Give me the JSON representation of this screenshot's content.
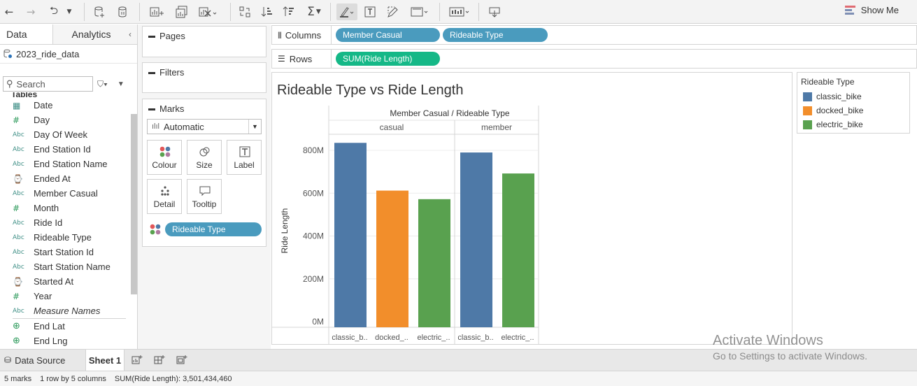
{
  "toolbar": {
    "show_me_label": "Show Me",
    "icons": [
      "back-arrow-icon",
      "forward-arrow-icon",
      "redo-icon",
      "dropdown-icon",
      "new-datasource-icon",
      "pause-updates-icon",
      "new-worksheet-icon",
      "duplicate-sheet-icon",
      "clear-sheet-icon",
      "swap-rows-columns-icon",
      "sort-ascending-icon",
      "sort-descending-icon",
      "totals-icon",
      "highlight-icon",
      "show-labels-icon",
      "pen-icon",
      "fit-icon",
      "present-icon",
      "share-icon"
    ]
  },
  "left_pane": {
    "tabs": {
      "data": "Data",
      "analytics": "Analytics"
    },
    "datasource": "2023_ride_data",
    "search_placeholder": "Search",
    "tables_label": "Tables",
    "fields": [
      {
        "type": "date",
        "name": "Date"
      },
      {
        "type": "number",
        "name": "Day"
      },
      {
        "type": "text",
        "name": "Day Of Week"
      },
      {
        "type": "text",
        "name": "End Station Id"
      },
      {
        "type": "text",
        "name": "End Station Name"
      },
      {
        "type": "datetime",
        "name": "Ended At"
      },
      {
        "type": "text",
        "name": "Member Casual"
      },
      {
        "type": "number",
        "name": "Month"
      },
      {
        "type": "text",
        "name": "Ride Id"
      },
      {
        "type": "text",
        "name": "Rideable Type"
      },
      {
        "type": "text",
        "name": "Start Station Id"
      },
      {
        "type": "text",
        "name": "Start Station Name"
      },
      {
        "type": "datetime",
        "name": "Started At"
      },
      {
        "type": "number",
        "name": "Year"
      },
      {
        "type": "text",
        "name": "Measure Names",
        "italic": true
      },
      {
        "type": "geo",
        "name": "End Lat"
      },
      {
        "type": "geo",
        "name": "End Lng"
      }
    ]
  },
  "cards": {
    "pages": "Pages",
    "filters": "Filters",
    "marks": "Marks",
    "mark_type": "Automatic",
    "buttons": {
      "colour": "Colour",
      "size": "Size",
      "label": "Label",
      "detail": "Detail",
      "tooltip": "Tooltip"
    },
    "colour_pill": "Rideable Type"
  },
  "shelves": {
    "columns_label": "Columns",
    "columns_pills": [
      "Member Casual",
      "Rideable Type"
    ],
    "rows_label": "Rows",
    "rows_pills": [
      "SUM(Ride Length)"
    ]
  },
  "viz": {
    "title": "Rideable Type vs Ride Length"
  },
  "legend": {
    "title": "Rideable Type",
    "items": [
      {
        "label": "classic_bike",
        "color": "#4e79a7"
      },
      {
        "label": "docked_bike",
        "color": "#f28e2b"
      },
      {
        "label": "electric_bike",
        "color": "#59a14f"
      }
    ]
  },
  "chart_data": {
    "type": "bar",
    "title": "Rideable Type vs Ride Length",
    "header": "Member Casual / Rideable Type",
    "ylabel": "Ride Length",
    "ylim": [
      0,
      900000000
    ],
    "y_ticks": [
      {
        "value": 0,
        "label": "0M"
      },
      {
        "value": 200000000,
        "label": "200M"
      },
      {
        "value": 400000000,
        "label": "400M"
      },
      {
        "value": 600000000,
        "label": "600M"
      },
      {
        "value": 800000000,
        "label": "800M"
      }
    ],
    "panes": [
      {
        "name": "casual",
        "bars": [
          {
            "category": "classic_bike",
            "axis_label": "classic_b..",
            "value": 835000000,
            "color": "#4e79a7"
          },
          {
            "category": "docked_bike",
            "axis_label": "docked_..",
            "value": 612000000,
            "color": "#f28e2b"
          },
          {
            "category": "electric_bike",
            "axis_label": "electric_..",
            "value": 572000000,
            "color": "#59a14f"
          }
        ]
      },
      {
        "name": "member",
        "bars": [
          {
            "category": "classic_bike",
            "axis_label": "classic_b..",
            "value": 790000000,
            "color": "#4e79a7"
          },
          {
            "category": "electric_bike",
            "axis_label": "electric_..",
            "value": 692000000,
            "color": "#59a14f"
          }
        ]
      }
    ],
    "grid": true,
    "legend": "right"
  },
  "bottom_tabs": {
    "data_source": "Data Source",
    "sheet": "Sheet 1"
  },
  "status": {
    "marks": "5 marks",
    "dims": "1 row by 5 columns",
    "sum": "SUM(Ride Length): 3,501,434,460"
  },
  "watermark": {
    "line1": "Activate Windows",
    "line2": "Go to Settings to activate Windows."
  }
}
